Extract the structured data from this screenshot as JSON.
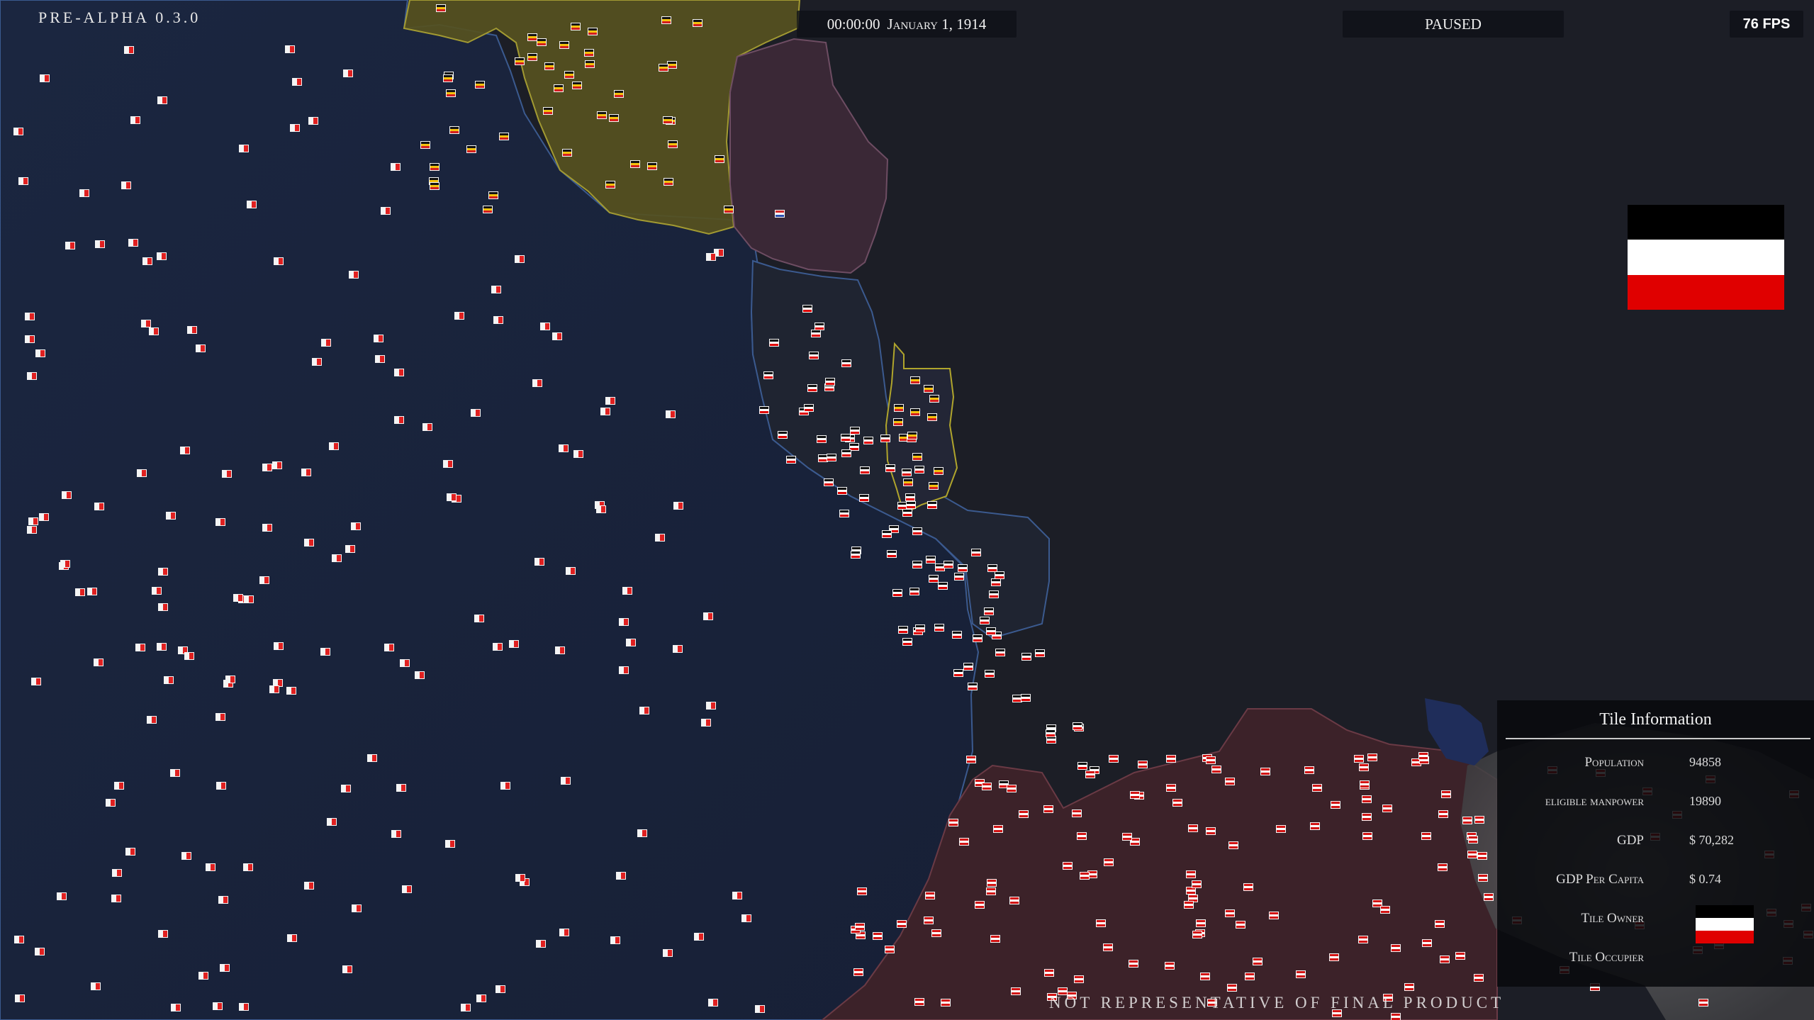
{
  "hud": {
    "version": "PRE-ALPHA 0.3.0",
    "clock": "00:00:00",
    "date": "January 1, 1914",
    "pause_state": "PAUSED",
    "fps": "76 FPS",
    "disclaimer": "NOT REPRESENTATIVE OF FINAL PRODUCT"
  },
  "selected_nation_flag": {
    "stripes": [
      "#000000",
      "#ffffff",
      "#e00000"
    ]
  },
  "tile_info": {
    "title": "Tile Information",
    "rows": [
      {
        "label": "Population",
        "value": "94858"
      },
      {
        "label": "eligible manpower",
        "value": "19890"
      },
      {
        "label": "GDP",
        "value": "$ 70,282"
      },
      {
        "label": "GDP Per Capita",
        "value": "$ 0.74"
      },
      {
        "label": "Tile Owner",
        "value": ""
      },
      {
        "label": "Tile Occupier",
        "value": ""
      }
    ],
    "owner_flag": [
      "#000000",
      "#ffffff",
      "#e00000"
    ]
  },
  "colors": {
    "sea": "#1b2741",
    "land_neutral": "#1d1f27",
    "belgium_region": "#57521f",
    "netherlands_region": "#3a2836",
    "germany_region": "#3a2229",
    "coast_line": "#3b5a8f"
  },
  "icons": {
    "city_marker": "flag-marker-icon"
  }
}
